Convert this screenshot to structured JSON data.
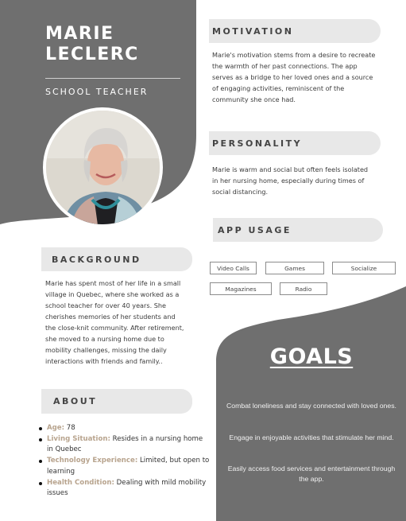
{
  "profile": {
    "name_first": "MARIE",
    "name_last": "LECLERC",
    "role": "SCHOOL TEACHER"
  },
  "motivation": {
    "heading": "MOTIVATION",
    "text": "Marie's motivation stems from a desire to recreate the warmth of her past connections. The app serves as a bridge to her loved ones and a source of engaging activities, reminiscent of the community she once had."
  },
  "personality": {
    "heading": "PERSONALITY",
    "text": "Marie is warm and social but often feels isolated in her nursing home, especially during times of social distancing."
  },
  "app_usage": {
    "heading": "APP USAGE",
    "tags": [
      "Video Calls",
      "Games",
      "Socialize",
      "Magazines",
      "Radio"
    ]
  },
  "background": {
    "heading": "BACKGROUND",
    "text": "Marie has spent most of her life in a small village in Quebec, where she worked as a school teacher for over 40 years. She cherishes memories of her students and the close-knit community. After retirement, she moved to a nursing home due to mobility challenges, missing the daily interactions with friends and family.."
  },
  "about": {
    "heading": "ABOUT",
    "items": [
      {
        "label": "Age:",
        "value": " 78"
      },
      {
        "label": "Living Situation:",
        "value": " Resides in a nursing home in Quebec"
      },
      {
        "label": "Technology Experience:",
        "value": " Limited, but open to learning"
      },
      {
        "label": "Health Condition:",
        "value": " Dealing with mild mobility issues"
      }
    ]
  },
  "goals": {
    "heading": "GOALS",
    "items": [
      "Combat loneliness and stay connected with loved ones.",
      "Engage in enjoyable activities that stimulate her mind.",
      "Easily access food services and entertainment through the app."
    ]
  },
  "colors": {
    "panel_gray": "#6f6f6f",
    "pill_gray": "#e8e8e8",
    "accent_tan": "#b8a48e",
    "white": "#ffffff"
  },
  "icons": [
    "avatar-photo"
  ]
}
